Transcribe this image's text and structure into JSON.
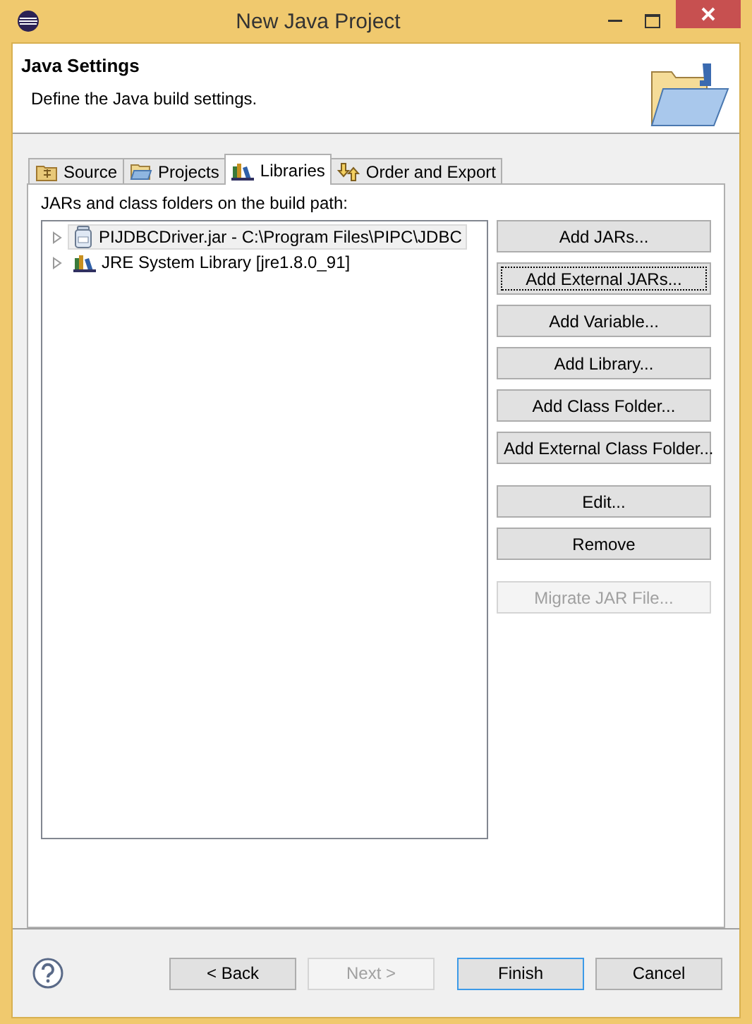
{
  "window": {
    "title": "New Java Project"
  },
  "header": {
    "title": "Java Settings",
    "description": "Define the Java build settings."
  },
  "tabs": [
    {
      "label": "Source",
      "kind": "source",
      "selected": false
    },
    {
      "label": "Projects",
      "kind": "projects",
      "selected": false
    },
    {
      "label": "Libraries",
      "kind": "libraries",
      "selected": true
    },
    {
      "label": "Order and Export",
      "kind": "order",
      "selected": false
    }
  ],
  "caption": "JARs and class folders on the build path:",
  "tree": [
    {
      "label": "PIJDBCDriver.jar - C:\\Program Files\\PIPC\\JDBC",
      "kind": "jar",
      "expanded": false,
      "selected": true
    },
    {
      "label": "JRE System Library [jre1.8.0_91]",
      "kind": "library",
      "expanded": false,
      "selected": false
    }
  ],
  "button_groups": [
    [
      {
        "label": "Add JARs...",
        "disabled": false,
        "focused": false
      },
      {
        "label": "Add External JARs...",
        "disabled": false,
        "focused": true
      },
      {
        "label": "Add Variable...",
        "disabled": false,
        "focused": false
      },
      {
        "label": "Add Library...",
        "disabled": false,
        "focused": false
      },
      {
        "label": "Add Class Folder...",
        "disabled": false,
        "focused": false
      },
      {
        "label": "Add External Class Folder...",
        "disabled": false,
        "focused": false
      }
    ],
    [
      {
        "label": "Edit...",
        "disabled": false,
        "focused": false
      },
      {
        "label": "Remove",
        "disabled": false,
        "focused": false
      }
    ],
    [
      {
        "label": "Migrate JAR File...",
        "disabled": true,
        "focused": false
      }
    ]
  ],
  "footer": [
    {
      "label": "< Back",
      "disabled": false,
      "default": false
    },
    {
      "label": "Next >",
      "disabled": true,
      "default": false
    },
    {
      "label": "Finish",
      "disabled": false,
      "default": true
    },
    {
      "label": "Cancel",
      "disabled": false,
      "default": false
    }
  ]
}
